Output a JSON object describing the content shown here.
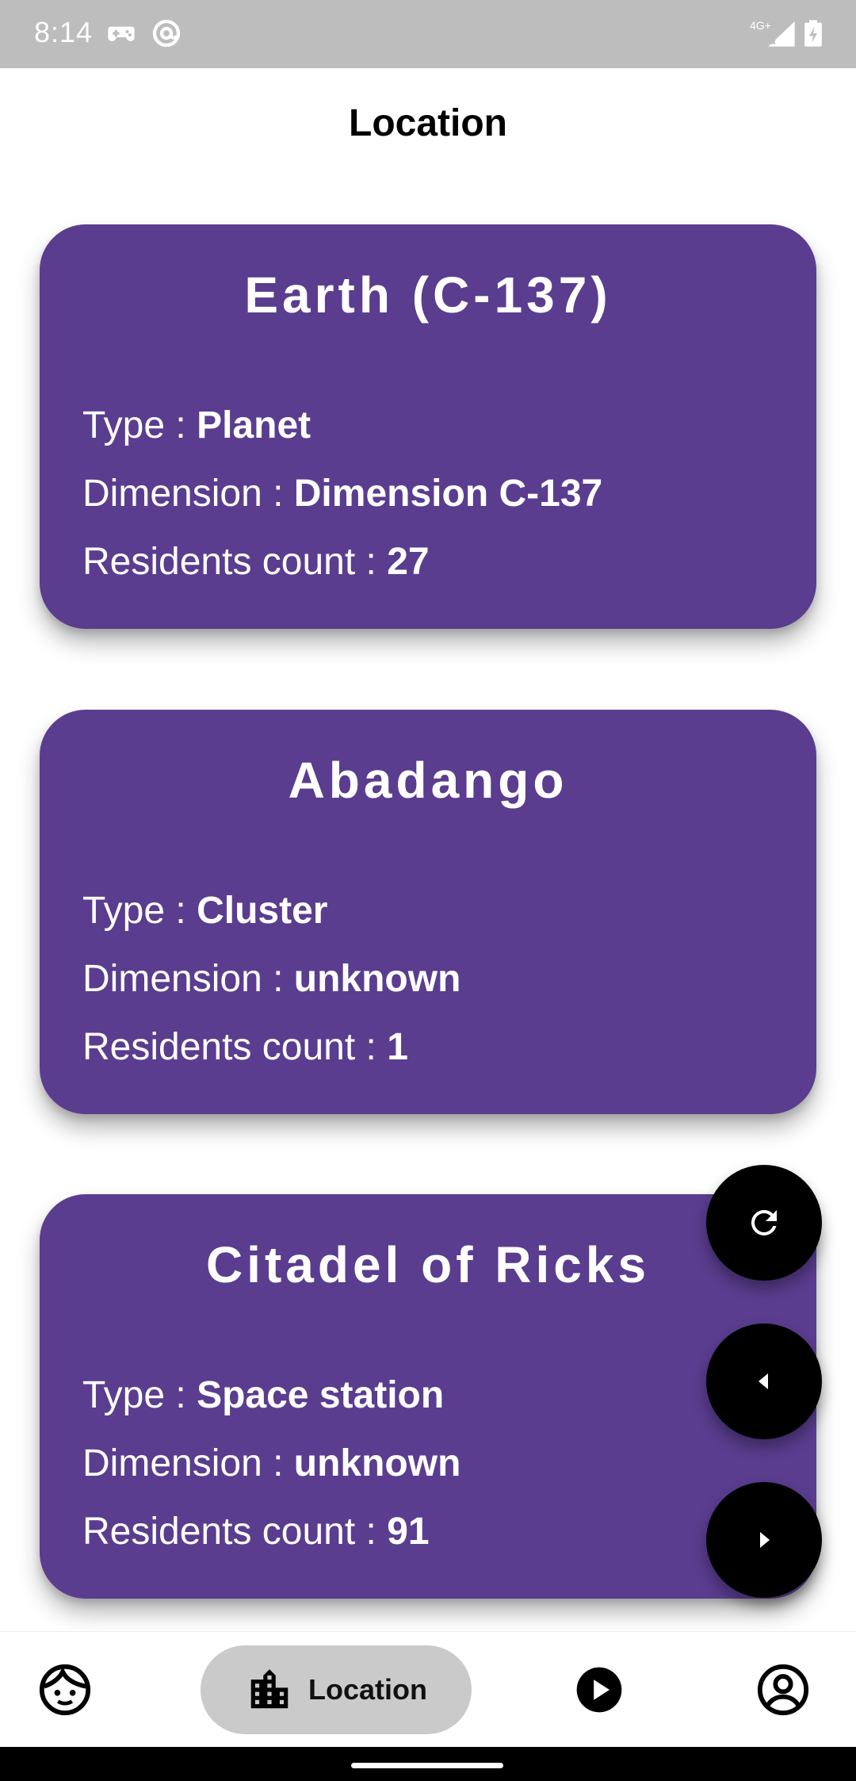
{
  "status_bar": {
    "time": "8:14",
    "network_label": "4G+",
    "left_icons": [
      "gamepad-icon",
      "at-sign-icon"
    ],
    "right_icons": [
      "signal-icon",
      "battery-charging-icon"
    ]
  },
  "page": {
    "title": "Location"
  },
  "labels": {
    "type": "Type : ",
    "dimension": "Dimension : ",
    "residents": "Residents count : "
  },
  "locations": [
    {
      "name": "Earth (C-137)",
      "type": "Planet",
      "dimension": "Dimension C-137",
      "residents": "27"
    },
    {
      "name": "Abadango",
      "type": "Cluster",
      "dimension": "unknown",
      "residents": "1"
    },
    {
      "name": "Citadel of Ricks",
      "type": "Space station",
      "dimension": "unknown",
      "residents": "91"
    }
  ],
  "fabs": [
    "refresh-icon",
    "previous-page-icon",
    "next-page-icon"
  ],
  "bottom_nav": {
    "items": [
      {
        "icon": "character-face-icon",
        "label": ""
      },
      {
        "icon": "city-building-icon",
        "label": "Location"
      },
      {
        "icon": "play-episode-icon",
        "label": ""
      },
      {
        "icon": "account-icon",
        "label": ""
      }
    ]
  },
  "colors": {
    "card": "#5a3d8f",
    "status_bar": "#bdbdbd",
    "nav_active": "#cacaca",
    "fab": "#000000"
  }
}
